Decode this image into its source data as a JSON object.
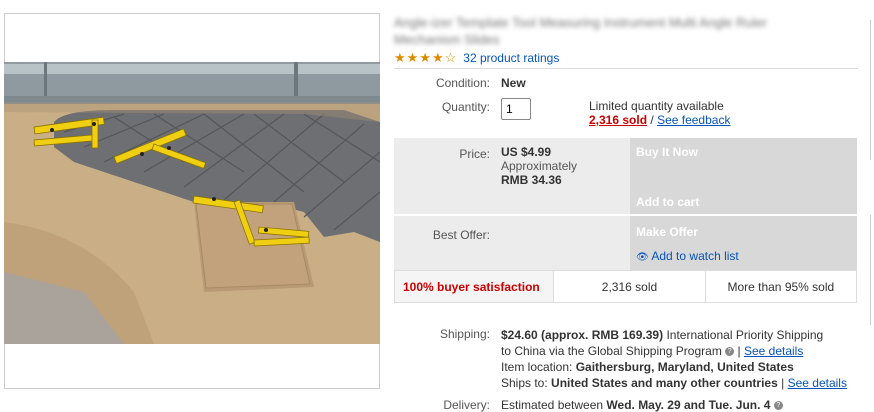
{
  "listing": {
    "title": "Angle-izer Template Tool Measuring Instrument Multi Angle Ruler Mechanism Slides",
    "stars": "★★★★☆",
    "ratings_label": "32 product ratings"
  },
  "condition": {
    "label": "Condition:",
    "value": "New"
  },
  "quantity": {
    "label": "Quantity:",
    "value": "1",
    "limited": "Limited quantity available",
    "sold": "2,316 sold",
    "separator": "/",
    "feedback": "See feedback"
  },
  "price": {
    "label": "Price:",
    "value": "US $4.99",
    "approx": "Approximately",
    "rmb": "RMB 34.36",
    "buy_now": "Buy It Now",
    "add_to_cart": "Add to cart"
  },
  "best_offer": {
    "label": "Best Offer:",
    "make_offer": "Make Offer",
    "watch": "Add to watch list"
  },
  "stats": {
    "satisfaction": "100% buyer satisfaction",
    "sold": "2,316 sold",
    "more_than": "More than 95% sold"
  },
  "shipping": {
    "label": "Shipping:",
    "cost": "$24.60",
    "approx": "(approx. RMB 169.39)",
    "service": "International Priority Shipping",
    "to": "to China",
    "via": "via the Global Shipping Program",
    "details": "See details",
    "location_label": "Item location:",
    "location": "Gaithersburg, Maryland, United States",
    "ships_label": "Ships to:",
    "ships": "United States and many other countries",
    "details2": "See details"
  },
  "delivery": {
    "label": "Delivery:",
    "text": "Estimated between",
    "dates": "Wed. May. 29 and Tue. Jun. 4"
  }
}
